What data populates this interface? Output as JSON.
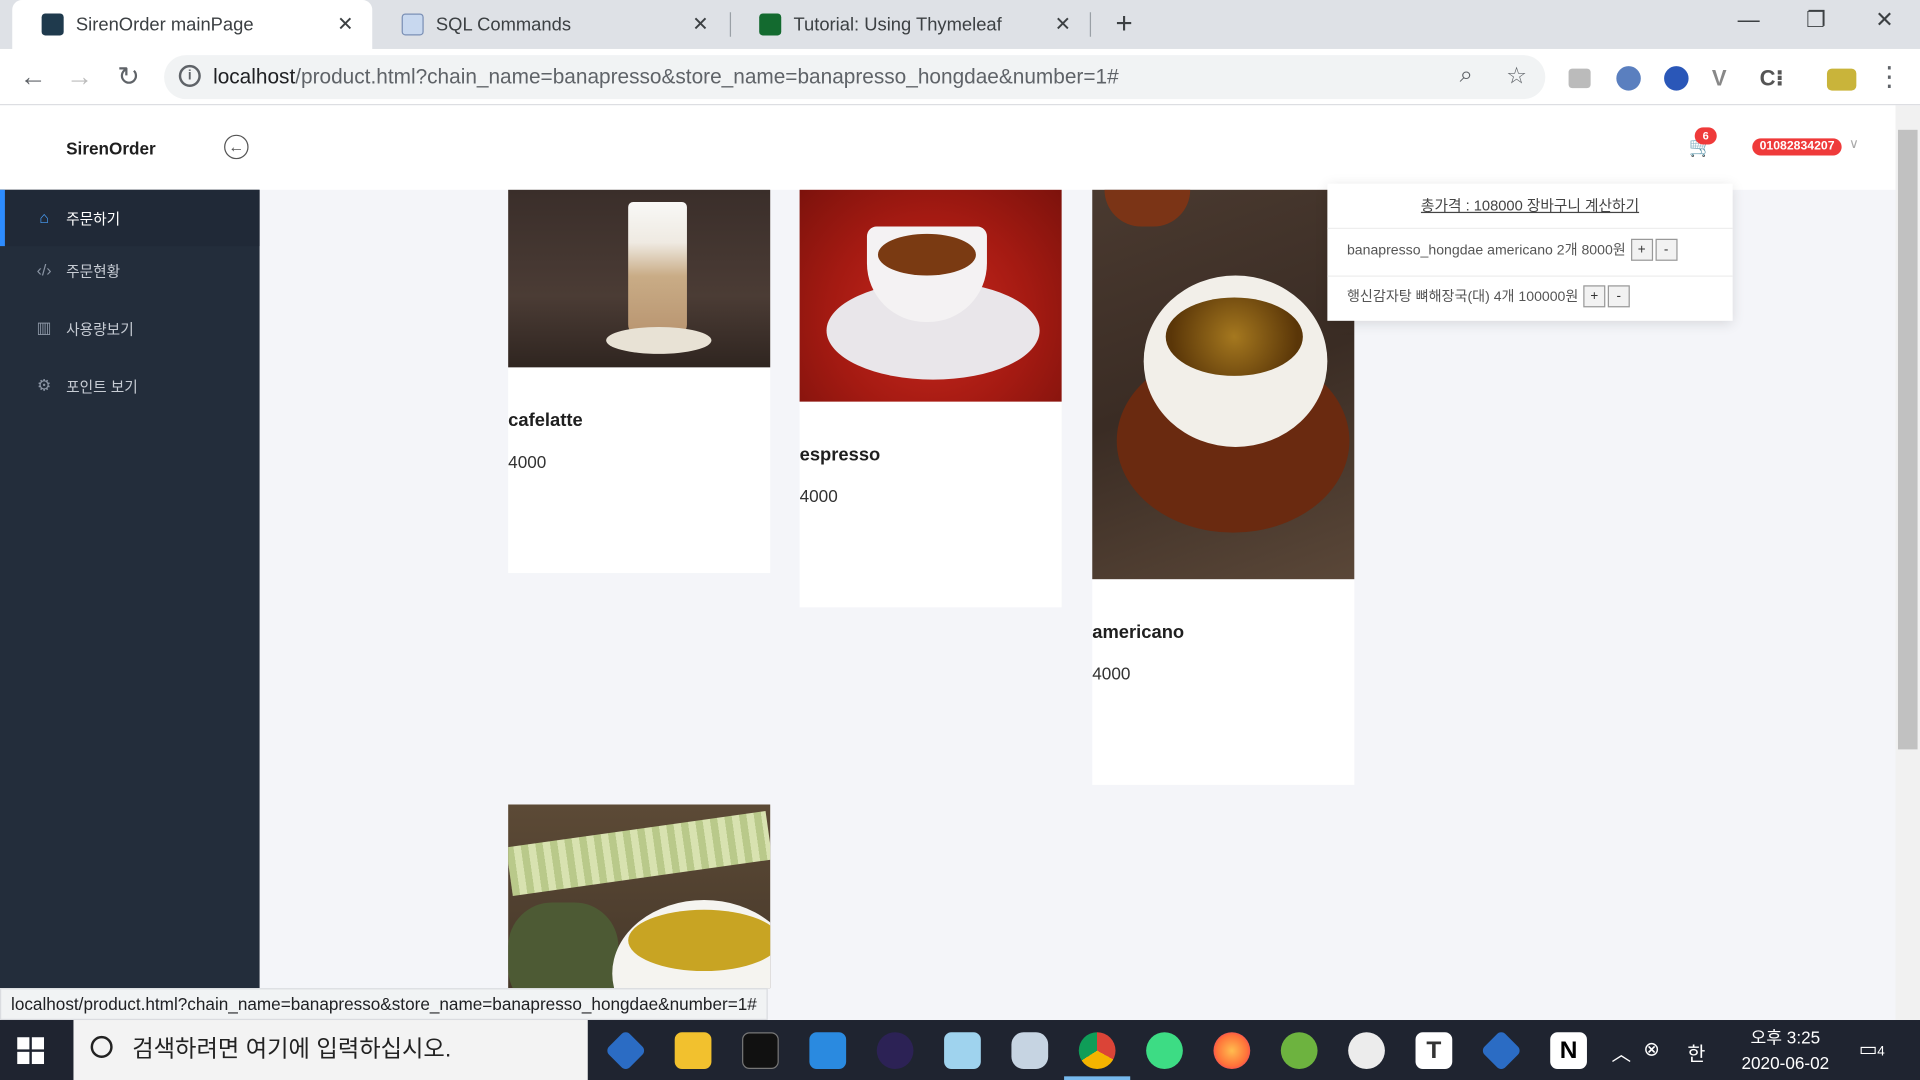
{
  "browser": {
    "tabs": [
      {
        "title": "SirenOrder mainPage",
        "active": true
      },
      {
        "title": "SQL Commands",
        "active": false
      },
      {
        "title": "Tutorial: Using Thymeleaf",
        "active": false
      }
    ],
    "url_host": "localhost",
    "url_rest": "/product.html?chain_name=banapresso&store_name=banapresso_hongdae&number=1#",
    "status_url": "localhost/product.html?chain_name=banapresso&store_name=banapresso_hongdae&number=1#"
  },
  "header": {
    "brand": "SirenOrder",
    "cart_count": "6",
    "phone": "01082834207"
  },
  "sidebar": {
    "items": [
      {
        "label": "주문하기",
        "icon": "home-icon",
        "active": true
      },
      {
        "label": "주문현황",
        "icon": "code-icon",
        "active": false
      },
      {
        "label": "사용량보기",
        "icon": "chart-icon",
        "active": false
      },
      {
        "label": "포인트 보기",
        "icon": "gear-icon",
        "active": false
      }
    ]
  },
  "products": [
    {
      "name": "cafelatte",
      "price": "4000"
    },
    {
      "name": "espresso",
      "price": "4000"
    },
    {
      "name": "americano",
      "price": "4000"
    },
    {
      "name": "",
      "price": ""
    }
  ],
  "cart_dropdown": {
    "total_text": "총가격 : 108000 장바구니 계산하기",
    "items": [
      {
        "text": "banapresso_hongdae americano 2개 8000원",
        "plus": "+",
        "minus": "-"
      },
      {
        "text": "행신감자탕 뼈해장국(대) 4개 100000원",
        "plus": "+",
        "minus": "-"
      }
    ]
  },
  "taskbar": {
    "search_placeholder": "검색하려면 여기에 입력하십시오.",
    "ime": "한",
    "time": "오후 3:25",
    "date": "2020-06-02",
    "notifications": "4"
  },
  "colors": {
    "sidebar_bg": "#232d3b",
    "accent": "#2d8cff",
    "badge": "#ef3a3a",
    "content_bg": "#f4f5f9"
  }
}
